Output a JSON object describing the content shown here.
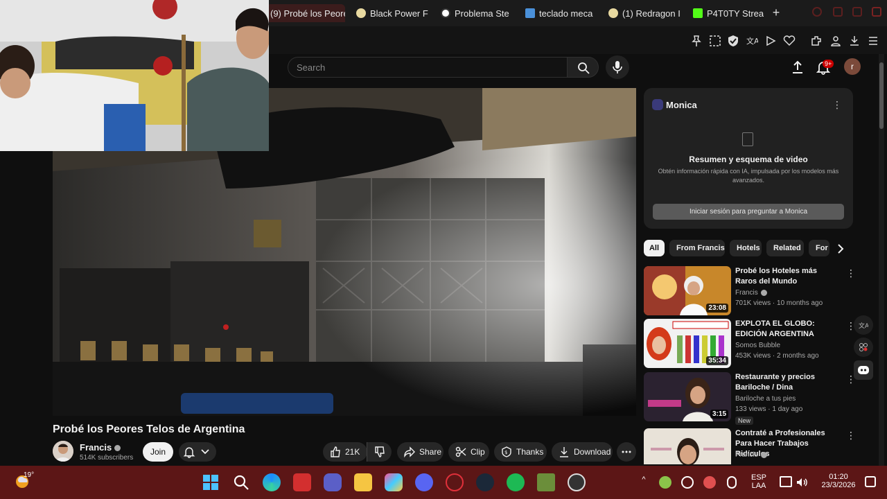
{
  "browser": {
    "tabs": [
      {
        "label": "(9) Probé los Peore"
      },
      {
        "label": "Black Power F"
      },
      {
        "label": "Problema Ste"
      },
      {
        "label": "teclado meca"
      },
      {
        "label": "(1) Redragon I"
      },
      {
        "label": "P4T0TY Strea"
      }
    ],
    "new_tab": "+"
  },
  "header": {
    "search_placeholder": "Search",
    "notifications_badge": "9+",
    "avatar_letter": "r"
  },
  "video": {
    "title": "Probé los Peores Telos de Argentina",
    "channel": "Francis",
    "subscribers": "514K subscribers",
    "join_label": "Join",
    "likes": "21K",
    "share_label": "Share",
    "clip_label": "Clip",
    "thanks_label": "Thanks",
    "download_label": "Download"
  },
  "monica": {
    "name": "Monica",
    "heading": "Resumen y esquema de video",
    "description": "Obtén información rápida con IA, impulsada por los modelos más avanzados.",
    "button": "Iniciar sesión para preguntar a Monica"
  },
  "chips": [
    "All",
    "From Francis",
    "Hotels",
    "Related",
    "For"
  ],
  "recommendations": [
    {
      "title": "Probé los Hoteles más Raros del Mundo",
      "channel": "Francis",
      "meta": "701K views · 10 months ago",
      "duration": "23:08"
    },
    {
      "title": "EXPLOTA EL GLOBO: EDICIÓN ARGENTINA",
      "channel": "Somos Bubble",
      "meta": "453K views · 2 months ago",
      "duration": "35:34",
      "thumb_text": "EXPLOTA EL GLOBO Y ENCUENTRA EL AMOR"
    },
    {
      "title": "Restaurante y precios Bariloche / Dina",
      "channel": "Bariloche a tus pies",
      "meta": "133 views · 1 day ago",
      "duration": "3:15",
      "badge": "New",
      "thumb_text": "Restaurante Dina Hugo"
    },
    {
      "title": "Contraté a Profesionales Para Hacer Trabajos Ridículos",
      "channel": "Francis",
      "meta": "",
      "duration": "",
      "thumb_text": "120"
    }
  ],
  "taskbar": {
    "temperature": "19°",
    "language": "ESP",
    "layout": "LAA",
    "time": "01:20",
    "date": "23/3/2026"
  },
  "colors": {
    "taskbar": "#5c1616",
    "background": "#0f0f0f",
    "notif_badge": "#cc0000"
  }
}
